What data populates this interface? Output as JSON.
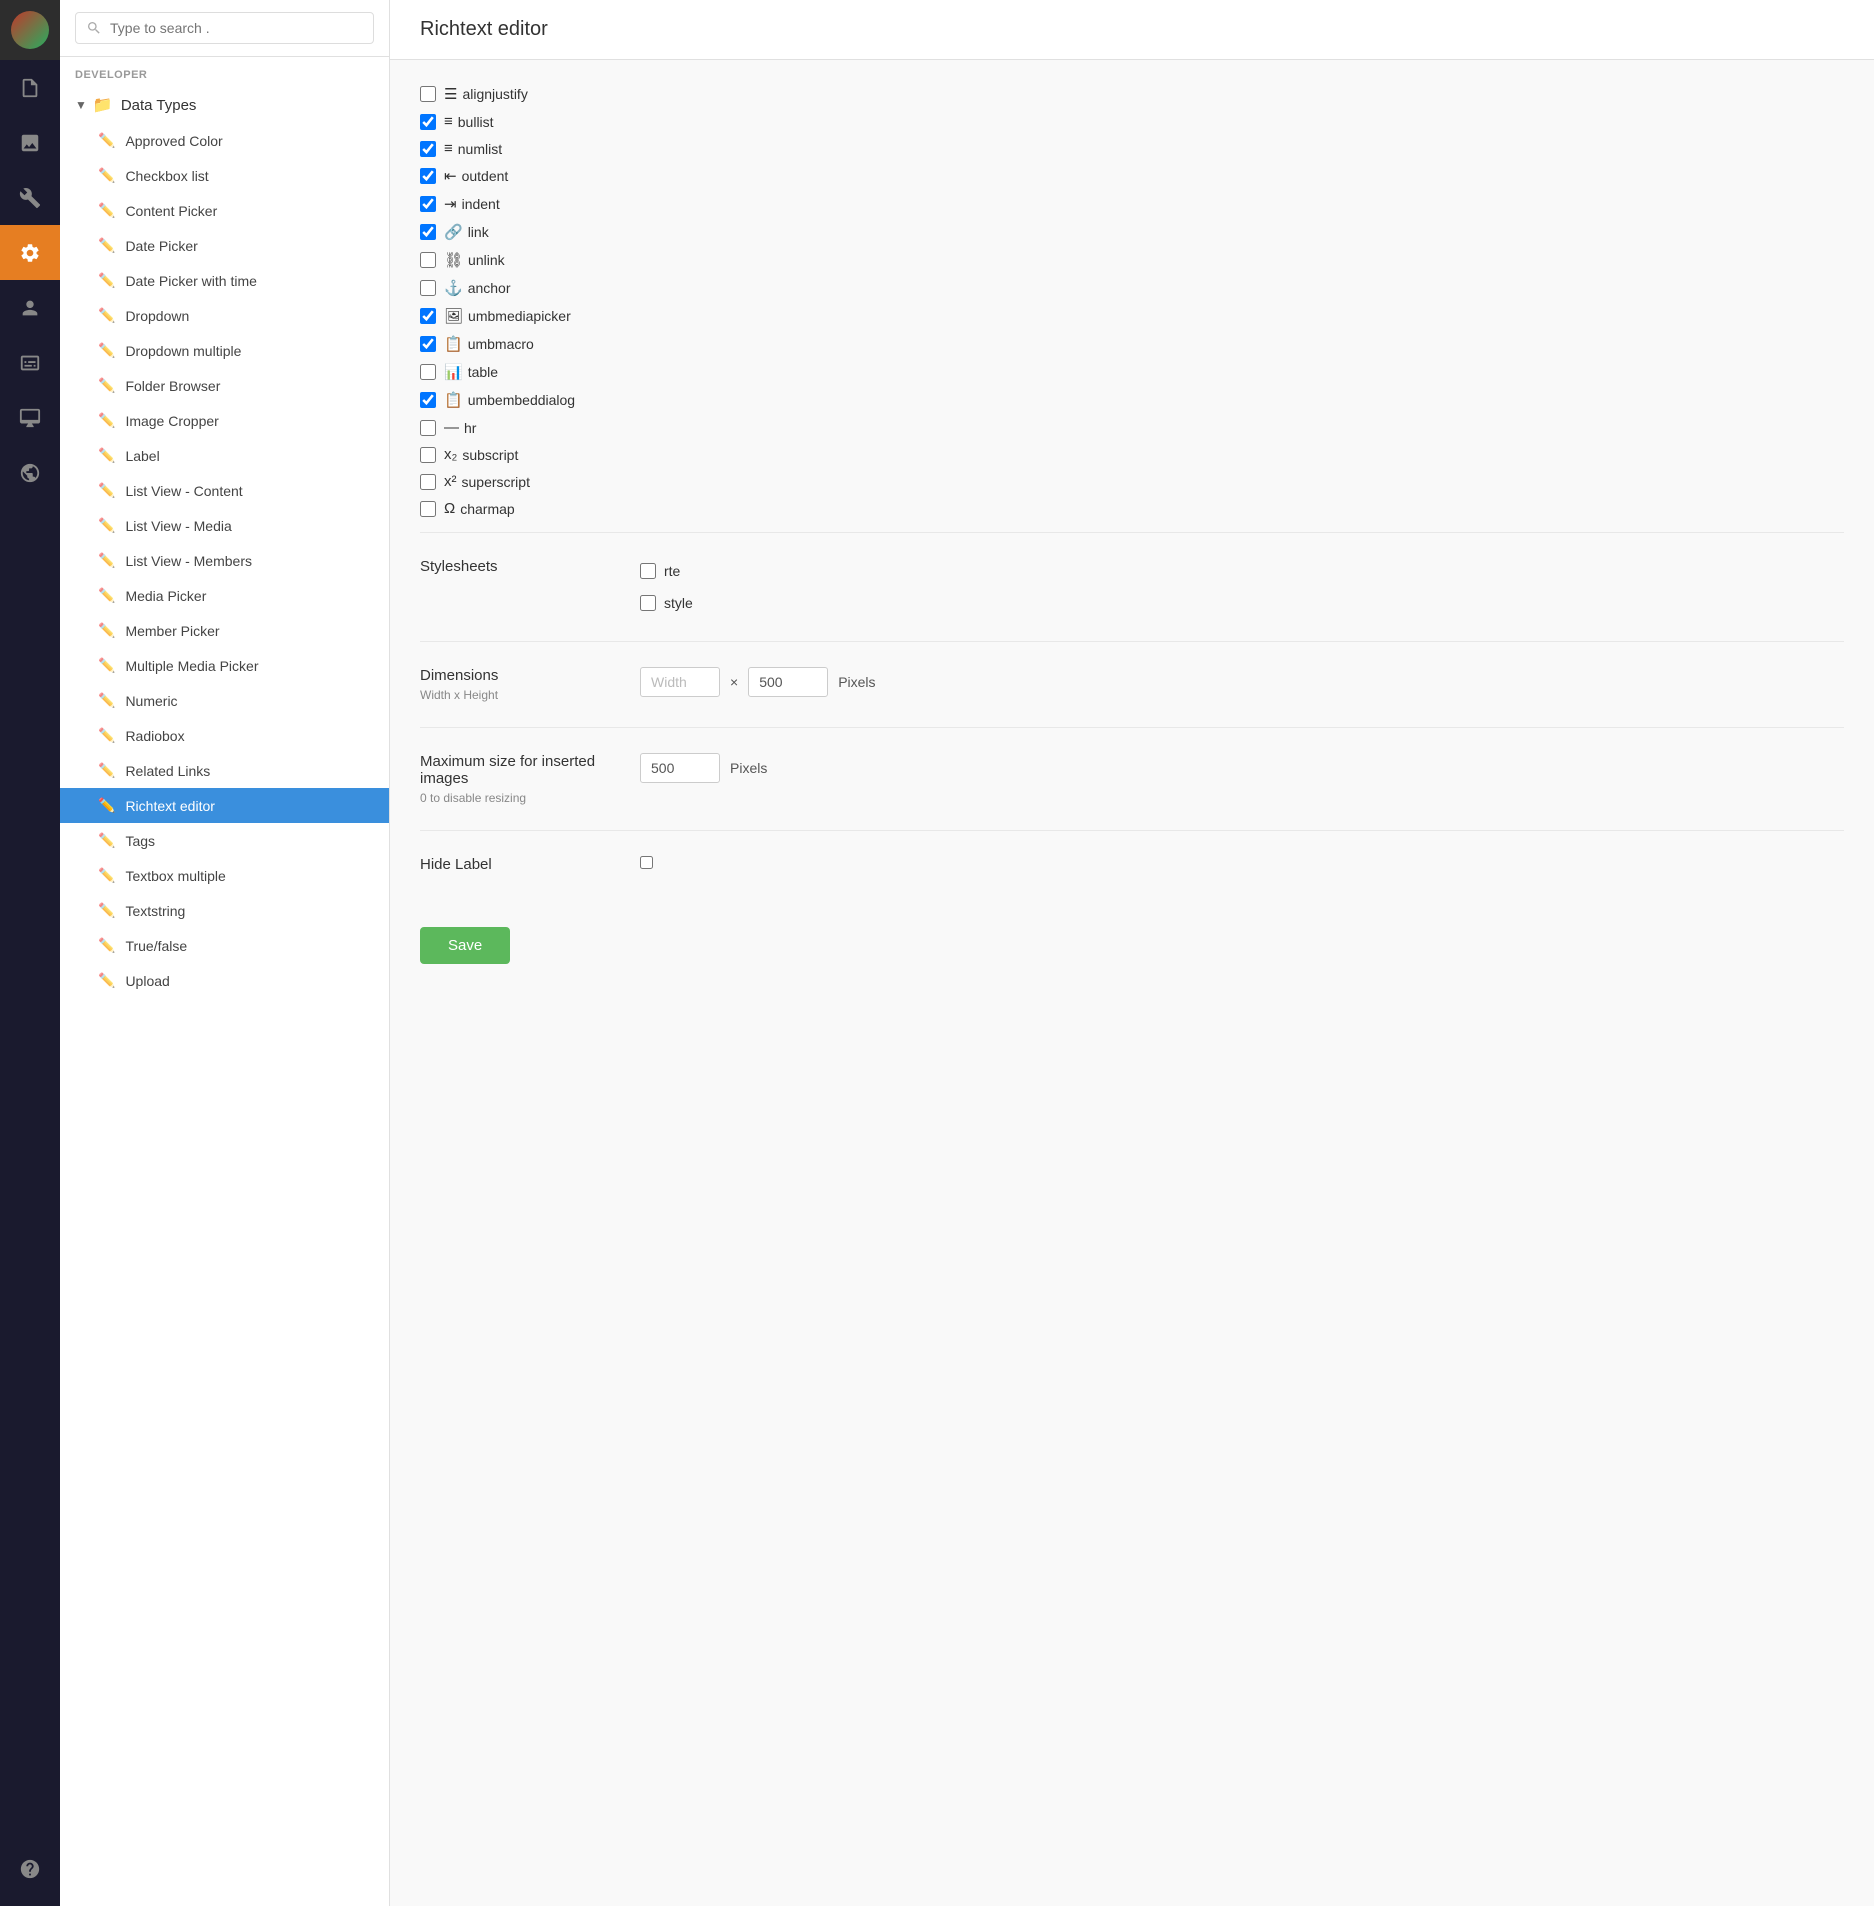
{
  "iconBar": {
    "items": [
      {
        "name": "document-icon",
        "label": "Content",
        "active": false
      },
      {
        "name": "image-icon",
        "label": "Media",
        "active": false
      },
      {
        "name": "wrench-icon",
        "label": "Settings",
        "active": false
      },
      {
        "name": "gear-icon",
        "label": "Developer",
        "active": true
      },
      {
        "name": "user-icon",
        "label": "Users",
        "active": false
      },
      {
        "name": "card-icon",
        "label": "Members",
        "active": false
      },
      {
        "name": "desktop-icon",
        "label": "Forms",
        "active": false
      },
      {
        "name": "globe-icon",
        "label": "Translation",
        "active": false
      }
    ],
    "bottomItem": {
      "name": "help-icon",
      "label": "Help"
    }
  },
  "search": {
    "placeholder": "Type to search ."
  },
  "sidebar": {
    "sectionLabel": "DEVELOPER",
    "groupLabel": "Data Types",
    "items": [
      {
        "label": "Approved Color",
        "active": false
      },
      {
        "label": "Checkbox list",
        "active": false
      },
      {
        "label": "Content Picker",
        "active": false
      },
      {
        "label": "Date Picker",
        "active": false,
        "showDots": true
      },
      {
        "label": "Date Picker with time",
        "active": false
      },
      {
        "label": "Dropdown",
        "active": false
      },
      {
        "label": "Dropdown multiple",
        "active": false
      },
      {
        "label": "Folder Browser",
        "active": false
      },
      {
        "label": "Image Cropper",
        "active": false
      },
      {
        "label": "Label",
        "active": false
      },
      {
        "label": "List View - Content",
        "active": false
      },
      {
        "label": "List View - Media",
        "active": false
      },
      {
        "label": "List View - Members",
        "active": false
      },
      {
        "label": "Media Picker",
        "active": false
      },
      {
        "label": "Member Picker",
        "active": false
      },
      {
        "label": "Multiple Media Picker",
        "active": false
      },
      {
        "label": "Numeric",
        "active": false
      },
      {
        "label": "Radiobox",
        "active": false
      },
      {
        "label": "Related Links",
        "active": false
      },
      {
        "label": "Richtext editor",
        "active": true
      },
      {
        "label": "Tags",
        "active": false
      },
      {
        "label": "Textbox multiple",
        "active": false
      },
      {
        "label": "Textstring",
        "active": false
      },
      {
        "label": "True/false",
        "active": false
      },
      {
        "label": "Upload",
        "active": false
      }
    ]
  },
  "main": {
    "title": "Richtext editor",
    "checkboxes": [
      {
        "label": "alignjustify",
        "icon": "☰",
        "checked": false
      },
      {
        "label": "bullist",
        "icon": "≡",
        "checked": true
      },
      {
        "label": "numlist",
        "icon": "≡",
        "checked": true
      },
      {
        "label": "outdent",
        "icon": "⇤",
        "checked": true
      },
      {
        "label": "indent",
        "icon": "⇥",
        "checked": true
      },
      {
        "label": "link",
        "icon": "🔗",
        "checked": true
      },
      {
        "label": "unlink",
        "icon": "⛓",
        "checked": false
      },
      {
        "label": "anchor",
        "icon": "⚓",
        "checked": false
      },
      {
        "label": "umbmediapicker",
        "icon": "🖼",
        "checked": true
      },
      {
        "label": "umbmacro",
        "icon": "📋",
        "checked": true
      },
      {
        "label": "table",
        "icon": "📊",
        "checked": false
      },
      {
        "label": "umbembeddialog",
        "icon": "📋",
        "checked": true
      },
      {
        "label": "hr",
        "icon": "—",
        "checked": false
      },
      {
        "label": "subscript",
        "icon": "x₂",
        "checked": false
      },
      {
        "label": "superscript",
        "icon": "x²",
        "checked": false
      },
      {
        "label": "charmap",
        "icon": "Ω",
        "checked": false
      }
    ],
    "stylesheets": {
      "label": "Stylesheets",
      "items": [
        {
          "label": "rte",
          "checked": false
        },
        {
          "label": "style",
          "checked": false
        }
      ]
    },
    "dimensions": {
      "label": "Dimensions",
      "sublabel": "Width x Height",
      "widthPlaceholder": "Width",
      "heightValue": "500",
      "pixelsLabel": "Pixels"
    },
    "maxSize": {
      "label": "Maximum size for inserted images",
      "sublabel": "0 to disable resizing",
      "value": "500",
      "pixelsLabel": "Pixels"
    },
    "hideLabel": {
      "label": "Hide Label",
      "checked": false
    },
    "saveButton": "Save"
  }
}
